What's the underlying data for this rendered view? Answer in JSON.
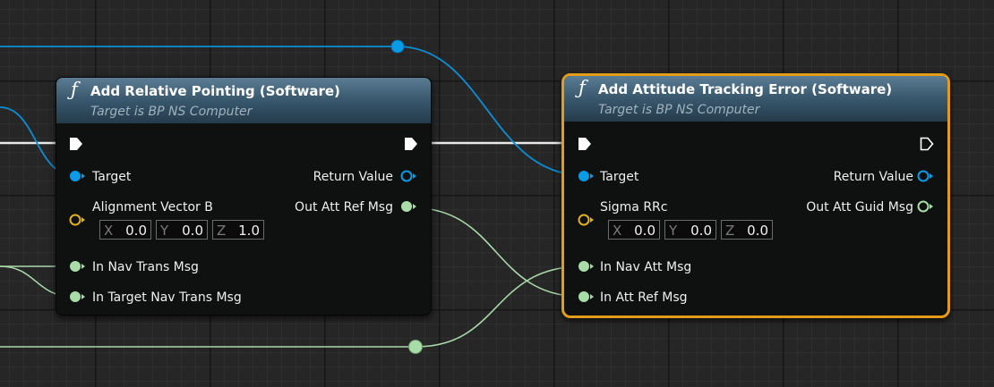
{
  "nodes": [
    {
      "id": "add-relative-pointing",
      "title": "Add Relative Pointing (Software)",
      "subtitle": "Target is BP NS Computer",
      "inputs": [
        {
          "label": "",
          "type": "exec"
        },
        {
          "label": "Target",
          "type": "object"
        },
        {
          "label": "Alignment Vector B",
          "type": "vector",
          "values": {
            "X": "0.0",
            "Y": "0.0",
            "Z": "1.0"
          }
        },
        {
          "label": "In Nav Trans Msg",
          "type": "struct"
        },
        {
          "label": "In Target Nav Trans Msg",
          "type": "struct"
        }
      ],
      "outputs": [
        {
          "label": "",
          "type": "exec"
        },
        {
          "label": "Return Value",
          "type": "object"
        },
        {
          "label": "Out Att Ref Msg",
          "type": "struct"
        }
      ],
      "selected": false
    },
    {
      "id": "add-attitude-tracking-error",
      "title": "Add Attitude Tracking Error (Software)",
      "subtitle": "Target is BP NS Computer",
      "inputs": [
        {
          "label": "",
          "type": "exec"
        },
        {
          "label": "Target",
          "type": "object"
        },
        {
          "label": "Sigma RRc",
          "type": "vector",
          "values": {
            "X": "0.0",
            "Y": "0.0",
            "Z": "0.0"
          }
        },
        {
          "label": "In Nav Att Msg",
          "type": "struct"
        },
        {
          "label": "In Att Ref Msg",
          "type": "struct"
        }
      ],
      "outputs": [
        {
          "label": "",
          "type": "exec"
        },
        {
          "label": "Return Value",
          "type": "object"
        },
        {
          "label": "Out Att Guid Msg",
          "type": "struct"
        }
      ],
      "selected": true
    }
  ],
  "colors": {
    "background": "#262626",
    "exec_wire": "#ffffff",
    "object_pin": "#0a9be8",
    "struct_pin": "#a8dca8",
    "vector_pin": "#e0b023",
    "selection": "#e49b17",
    "header": "#3b5a70"
  },
  "icons": {
    "function": "function-f-icon",
    "exec_pin": "exec-arrow-icon",
    "reroute": "reroute-knot-icon"
  }
}
